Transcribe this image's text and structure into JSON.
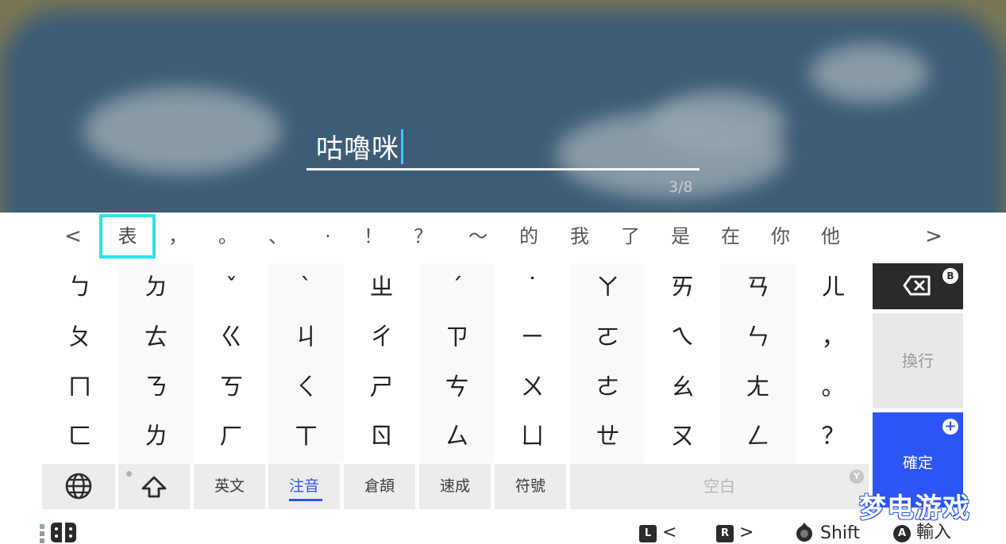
{
  "input": {
    "text": "咕嚕咪",
    "char_count": "3/8"
  },
  "suggestions": {
    "prev_arrow": "<",
    "next_arrow": ">",
    "selected": "表",
    "items": [
      "，",
      "。",
      "、",
      "·",
      "！",
      "？",
      "～",
      "的",
      "我",
      "了",
      "是",
      "在",
      "你",
      "他"
    ]
  },
  "keys": {
    "rows": [
      [
        "ㄅ",
        "ㄉ",
        "ˇ",
        "ˋ",
        "ㄓ",
        "ˊ",
        "˙",
        "ㄚ",
        "ㄞ",
        "ㄢ",
        "ㄦ"
      ],
      [
        "ㄆ",
        "ㄊ",
        "ㄍ",
        "ㄐ",
        "ㄔ",
        "ㄗ",
        "ㄧ",
        "ㄛ",
        "ㄟ",
        "ㄣ",
        "，"
      ],
      [
        "ㄇ",
        "ㄋ",
        "ㄎ",
        "ㄑ",
        "ㄕ",
        "ㄘ",
        "ㄨ",
        "ㄜ",
        "ㄠ",
        "ㄤ",
        "。"
      ],
      [
        "ㄈ",
        "ㄌ",
        "ㄏ",
        "ㄒ",
        "ㄖ",
        "ㄙ",
        "ㄩ",
        "ㄝ",
        "ㄡ",
        "ㄥ",
        "？"
      ]
    ]
  },
  "side_keys": {
    "backspace_badge": "B",
    "newline": "換行",
    "confirm": "確定",
    "confirm_badge": "+"
  },
  "bottom_row": {
    "english": "英文",
    "zhuyin": "注音",
    "cangjie": "倉頡",
    "quick": "速成",
    "symbols": "符號",
    "space": "空白",
    "space_badge": "Y"
  },
  "footer": {
    "l_badge": "L",
    "l_label": "<",
    "r_badge": "R",
    "r_label": ">",
    "shift_label": "Shift",
    "a_badge": "A",
    "a_label": "輸入"
  },
  "watermark": "梦电游戏",
  "colors": {
    "accent_blue": "#2d55f5",
    "selection_cyan": "#2de1e8",
    "caret": "#3cc8ff"
  }
}
